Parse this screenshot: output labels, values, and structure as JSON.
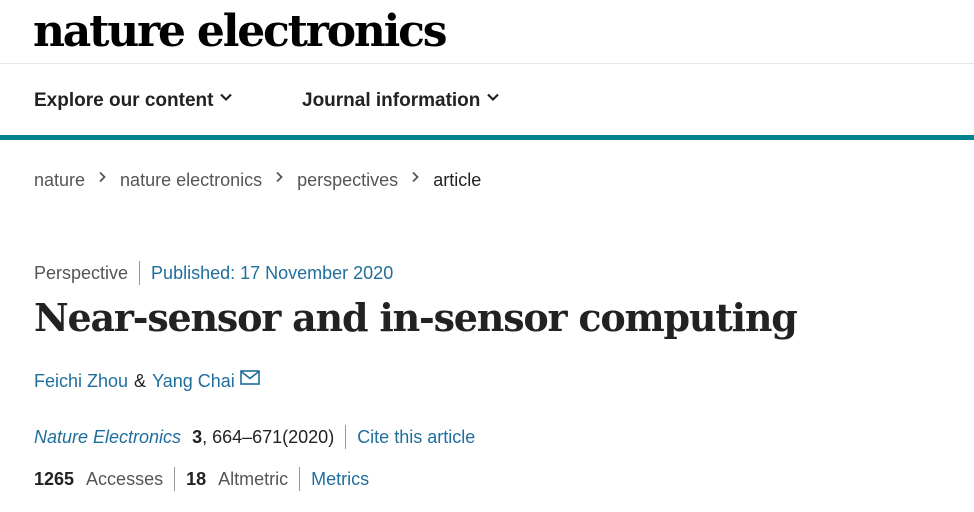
{
  "header": {
    "logo": "nature electronics"
  },
  "nav": {
    "explore_label": "Explore our content",
    "journal_label": "Journal information"
  },
  "breadcrumb": {
    "items": [
      "nature",
      "nature electronics",
      "perspectives",
      "article"
    ]
  },
  "article": {
    "type": "Perspective",
    "published": "Published: 17 November 2020",
    "title": "Near-sensor and in-sensor computing",
    "authors": [
      "Feichi Zhou",
      "Yang Chai"
    ],
    "author_separator": "&",
    "journal": "Nature Electronics",
    "volume": "3",
    "pages_year": ", 664–671(2020)",
    "cite_label": "Cite this article"
  },
  "metrics": {
    "accesses_count": "1265",
    "accesses_label": "Accesses",
    "altmetric_count": "18",
    "altmetric_label": "Altmetric",
    "metrics_link": "Metrics"
  },
  "colors": {
    "brand_teal": "#00838f",
    "link_blue": "#1f6e9c",
    "text": "#222222",
    "muted": "#555555"
  },
  "icons": {
    "nav_chevron": "chevron-down-icon",
    "breadcrumb_separator": "chevron-right-icon",
    "corresponding_author": "mail-icon"
  }
}
